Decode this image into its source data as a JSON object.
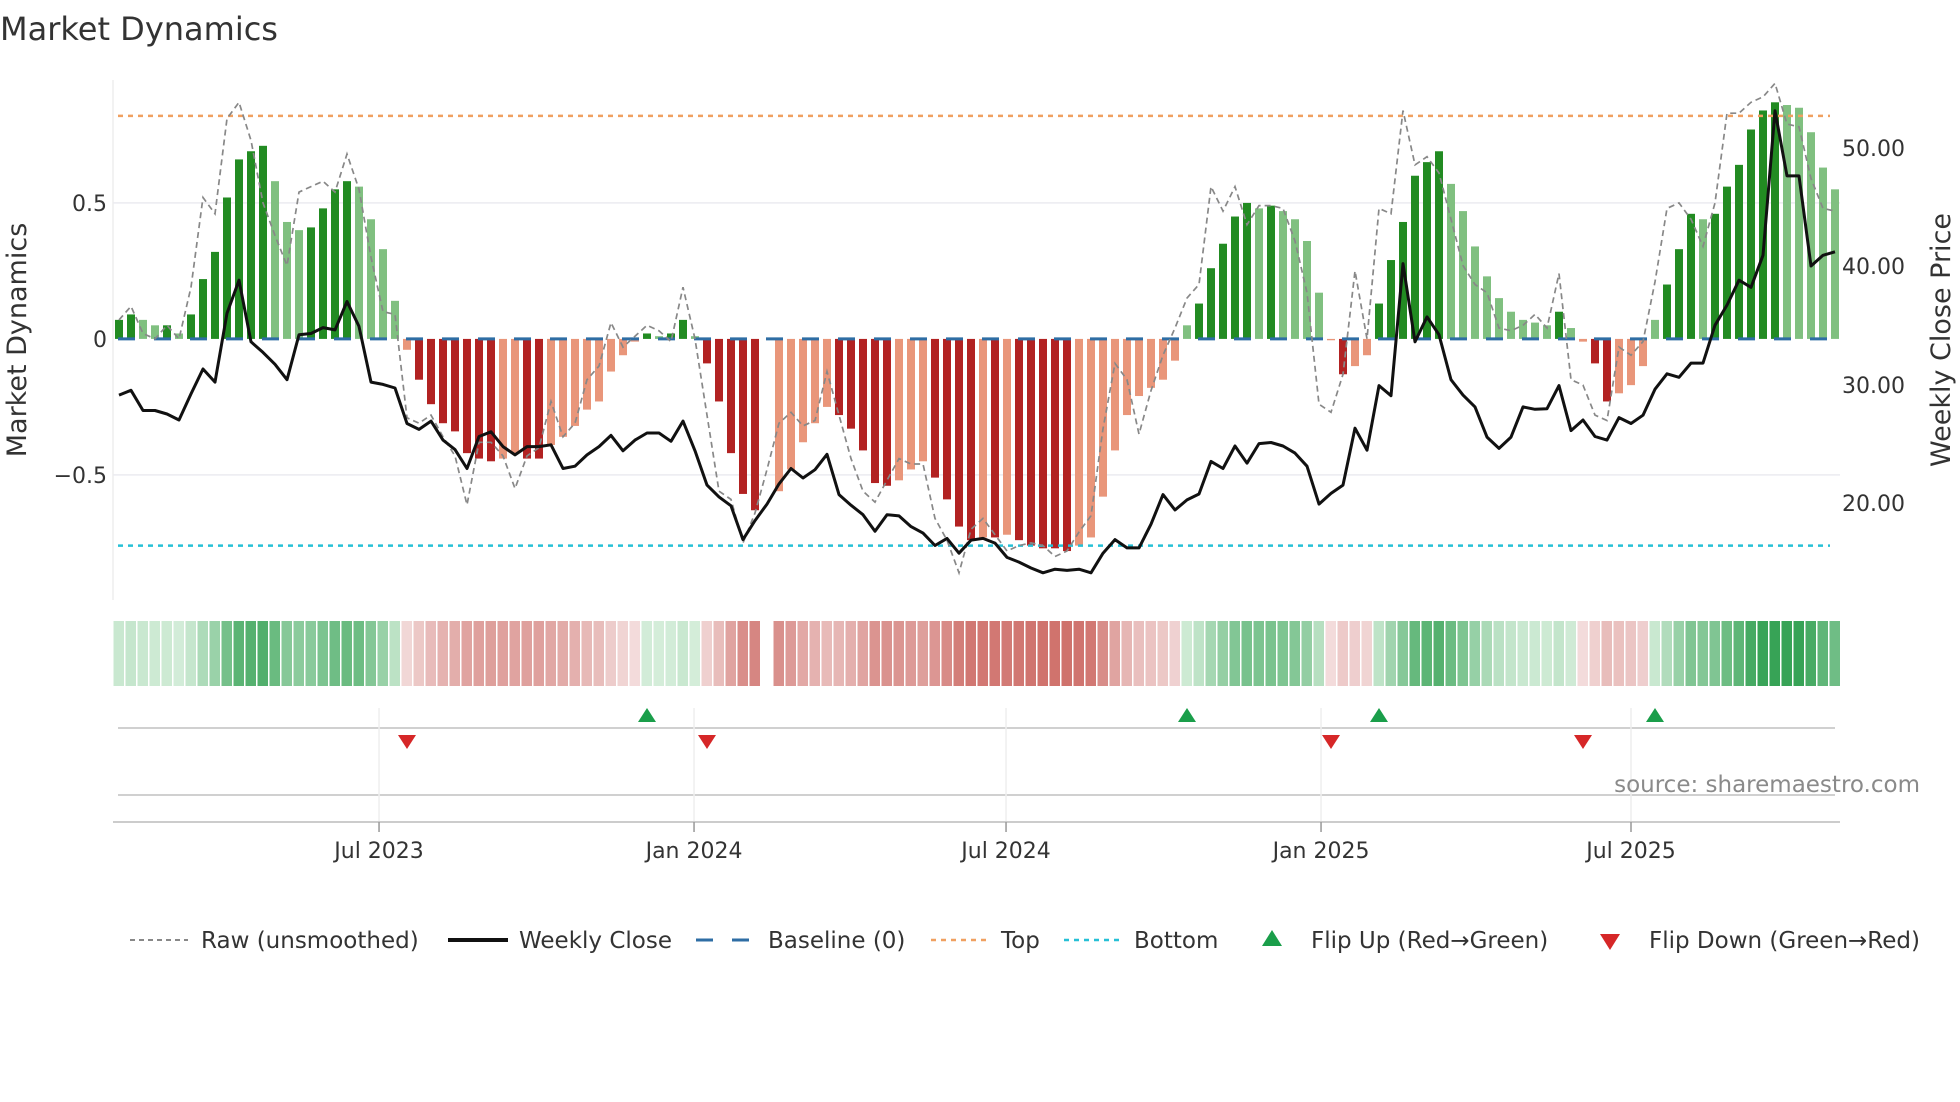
{
  "title": "Market Dynamics",
  "chart_data": {
    "type": "bar",
    "title": "Market Dynamics",
    "frequency": "weekly",
    "start_week": "2023-01-30",
    "left_axis": {
      "label": "Market Dynamics",
      "ticks": [
        0.5,
        0,
        -0.5
      ],
      "tick_labels": [
        "0.5",
        "0",
        "−0.5"
      ],
      "range": [
        -0.96,
        0.952
      ]
    },
    "right_axis": {
      "label": "Weekly Close Price",
      "ticks": [
        50,
        40,
        30,
        20
      ],
      "tick_labels": [
        "50.00",
        "40.00",
        "30.00",
        "20.00"
      ],
      "range": [
        11.8,
        55.7
      ]
    },
    "x_ticks": [
      {
        "label": "Jul 2023",
        "week": 22.67
      },
      {
        "label": "Jan 2024",
        "week": 48.92
      },
      {
        "label": "Jul 2024",
        "week": 74.92
      },
      {
        "label": "Jan 2025",
        "week": 101.17
      },
      {
        "label": "Jul 2025",
        "week": 127.0
      }
    ],
    "top": 0.82,
    "bottom": -0.76,
    "baseline": 0,
    "momentum": [
      0.07,
      0.09,
      0.07,
      0.05,
      0.05,
      0.02,
      0.09,
      0.22,
      0.32,
      0.52,
      0.66,
      0.69,
      0.71,
      0.58,
      0.43,
      0.4,
      0.41,
      0.48,
      0.55,
      0.58,
      0.56,
      0.44,
      0.33,
      0.14,
      -0.04,
      -0.15,
      -0.24,
      -0.31,
      -0.34,
      -0.42,
      -0.44,
      -0.45,
      -0.44,
      -0.42,
      -0.44,
      -0.44,
      -0.39,
      -0.36,
      -0.32,
      -0.26,
      -0.23,
      -0.12,
      -0.06,
      -0.01,
      0.02,
      0.01,
      0.02,
      0.07,
      0.01,
      -0.09,
      -0.23,
      -0.42,
      -0.57,
      -0.63,
      null,
      -0.56,
      -0.48,
      -0.38,
      -0.31,
      -0.25,
      -0.28,
      -0.33,
      -0.41,
      -0.53,
      -0.54,
      -0.52,
      -0.48,
      -0.45,
      -0.51,
      -0.59,
      -0.69,
      -0.74,
      -0.73,
      -0.73,
      -0.72,
      -0.74,
      -0.76,
      -0.77,
      -0.77,
      -0.78,
      -0.76,
      -0.73,
      -0.58,
      -0.41,
      -0.28,
      -0.21,
      -0.18,
      -0.15,
      -0.08,
      0.05,
      0.13,
      0.26,
      0.35,
      0.45,
      0.5,
      0.48,
      0.49,
      0.47,
      0.44,
      0.36,
      0.17,
      -0.005,
      -0.13,
      -0.1,
      -0.06,
      0.13,
      0.29,
      0.43,
      0.6,
      0.65,
      0.69,
      0.57,
      0.47,
      0.34,
      0.23,
      0.15,
      0.1,
      0.07,
      0.06,
      0.05,
      0.1,
      0.04,
      -0.01,
      -0.09,
      -0.23,
      -0.2,
      -0.17,
      -0.1,
      0.07,
      0.2,
      0.33,
      0.46,
      0.44,
      0.46,
      0.56,
      0.64,
      0.77,
      0.84,
      0.87,
      0.86,
      0.85,
      0.76,
      0.63,
      0.55
    ],
    "raw": [
      0.07,
      0.12,
      0.02,
      0.0,
      0.05,
      0.0,
      0.19,
      0.52,
      0.46,
      0.81,
      0.87,
      0.73,
      0.5,
      0.38,
      0.27,
      0.54,
      0.56,
      0.58,
      0.54,
      0.68,
      0.55,
      0.3,
      0.1,
      0.09,
      -0.29,
      -0.31,
      -0.28,
      -0.36,
      -0.43,
      -0.61,
      -0.38,
      -0.38,
      -0.43,
      -0.55,
      -0.43,
      -0.4,
      -0.23,
      -0.36,
      -0.31,
      -0.15,
      -0.1,
      0.06,
      -0.03,
      0.01,
      0.05,
      0.03,
      -0.01,
      0.19,
      0.0,
      -0.28,
      -0.56,
      -0.59,
      -0.75,
      -0.64,
      -0.48,
      -0.31,
      -0.27,
      -0.32,
      -0.3,
      -0.12,
      -0.28,
      -0.44,
      -0.56,
      -0.6,
      -0.52,
      -0.44,
      -0.46,
      -0.46,
      -0.66,
      -0.74,
      -0.86,
      -0.7,
      -0.66,
      -0.72,
      -0.78,
      -0.76,
      -0.75,
      -0.76,
      -0.8,
      -0.78,
      -0.71,
      -0.65,
      -0.33,
      -0.09,
      -0.15,
      -0.35,
      -0.19,
      -0.06,
      0.04,
      0.15,
      0.2,
      0.56,
      0.47,
      0.56,
      0.42,
      0.49,
      0.49,
      0.48,
      0.36,
      0.17,
      -0.24,
      -0.27,
      -0.13,
      0.25,
      0.0,
      0.48,
      0.46,
      0.84,
      0.64,
      0.67,
      0.61,
      0.44,
      0.27,
      0.2,
      0.17,
      0.04,
      0.03,
      0.05,
      0.09,
      0.04,
      0.24,
      -0.15,
      -0.17,
      -0.28,
      -0.3,
      -0.03,
      -0.06,
      -0.01,
      0.21,
      0.48,
      0.5,
      0.44,
      0.34,
      0.5,
      0.83,
      0.83,
      0.87,
      0.89,
      0.94,
      0.79,
      0.78,
      0.59,
      0.48,
      0.47
    ],
    "close": [
      29.1,
      29.5,
      27.8,
      27.8,
      27.5,
      27.0,
      29.2,
      31.3,
      30.2,
      36.0,
      38.8,
      33.6,
      32.7,
      31.7,
      30.4,
      34.2,
      34.3,
      34.8,
      34.6,
      37.0,
      34.9,
      30.2,
      30.0,
      29.7,
      26.7,
      26.2,
      26.9,
      25.3,
      24.5,
      22.9,
      25.6,
      26.0,
      24.75,
      24.05,
      24.75,
      24.75,
      24.9,
      22.9,
      23.1,
      24.05,
      24.75,
      25.7,
      24.4,
      25.3,
      25.9,
      25.9,
      25.2,
      26.9,
      24.4,
      21.5,
      20.5,
      19.75,
      16.9,
      18.5,
      19.9,
      21.6,
      22.9,
      22.1,
      22.8,
      24.1,
      20.7,
      19.8,
      19.0,
      17.6,
      19.0,
      18.9,
      18.0,
      17.45,
      16.4,
      17.0,
      15.75,
      16.85,
      17.0,
      16.6,
      15.4,
      15.0,
      14.5,
      14.1,
      14.4,
      14.3,
      14.4,
      14.1,
      15.75,
      16.9,
      16.2,
      16.2,
      18.2,
      20.7,
      19.4,
      20.25,
      20.75,
      23.5,
      22.9,
      24.8,
      23.35,
      25.0,
      25.1,
      24.8,
      24.2,
      23.1,
      19.9,
      20.8,
      21.5,
      26.3,
      24.45,
      29.9,
      29.05,
      40.2,
      33.6,
      35.7,
      34.2,
      30.4,
      29.1,
      28.1,
      25.55,
      24.6,
      25.55,
      28.1,
      27.9,
      27.95,
      29.9,
      26.1,
      27.0,
      25.6,
      25.3,
      27.2,
      26.7,
      27.4,
      29.6,
      30.9,
      30.6,
      31.8,
      31.8,
      35.0,
      36.7,
      38.8,
      38.2,
      40.9,
      53.1,
      47.6,
      47.6,
      40.0,
      40.9,
      41.2
    ],
    "flip_up_weeks": [
      45,
      90,
      106,
      129
    ],
    "flip_down_weeks": [
      25,
      50,
      102,
      123
    ],
    "legend": {
      "placement": "bottom",
      "items": [
        "Raw (unsmoothed)",
        "Weekly Close",
        "Baseline (0)",
        "Top",
        "Bottom",
        "Flip Up (Red→Green)",
        "Flip Down (Green→Red)"
      ]
    }
  },
  "source": "source: sharemaestro.com",
  "colors": {
    "bar_pos_strong": "#228b22",
    "bar_pos_weak": "#80c080",
    "bar_neg_strong": "#b22222",
    "bar_neg_weak": "#e9967a",
    "raw": "#888888",
    "close": "#111111",
    "baseline": "#2e6da4",
    "top": "#f0a060",
    "bottom": "#26c0d6",
    "flip_up": "#1a9e4a",
    "flip_down": "#d62728"
  }
}
